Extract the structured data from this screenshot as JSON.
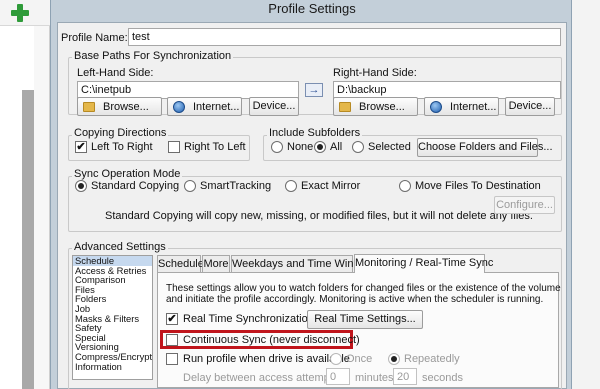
{
  "window": {
    "title": "Profile Settings"
  },
  "profile": {
    "name_label": "Profile Name:",
    "name_value": "test"
  },
  "base_paths": {
    "legend": "Base Paths For Synchronization",
    "left": {
      "label": "Left-Hand Side:",
      "value": "C:\\inetpub",
      "browse": "Browse...",
      "internet": "Internet...",
      "device": "Device..."
    },
    "right": {
      "label": "Right-Hand Side:",
      "value": "D:\\backup",
      "browse": "Browse...",
      "internet": "Internet...",
      "device": "Device..."
    },
    "arrow_left": "→",
    "arrow_right": "⇒",
    "left_icon": "folder-icon",
    "internet_icon": "globe-icon"
  },
  "copying_directions": {
    "legend": "Copying Directions",
    "left_to_right": "Left To Right",
    "right_to_left": "Right To Left",
    "left_to_right_checked": true,
    "right_to_left_checked": false
  },
  "include_subfolders": {
    "legend": "Include Subfolders",
    "options": [
      "None",
      "All",
      "Selected"
    ],
    "selected": "All",
    "button": "Choose Folders and Files..."
  },
  "sync_mode": {
    "legend": "Sync Operation Mode",
    "options": [
      "Standard Copying",
      "SmartTracking",
      "Exact Mirror",
      "Move Files To Destination"
    ],
    "selected": "Standard Copying",
    "description": "Standard Copying will copy new, missing, or modified files, but it will not delete any files.",
    "configure": "Configure..."
  },
  "advanced": {
    "legend": "Advanced Settings",
    "list": [
      "Schedule",
      "Access & Retries",
      "Comparison",
      "Files",
      "Folders",
      "Job",
      "Masks & Filters",
      "Safety",
      "Special",
      "Versioning",
      "Compress/Encrypt",
      "Information"
    ],
    "selected_list_item": "Schedule",
    "tabs": [
      "Schedule",
      "More",
      "Weekdays and Time Window",
      "Monitoring / Real-Time Sync"
    ],
    "active_tab": "Monitoring / Real-Time Sync",
    "panel": {
      "description_line1": "These settings allow you to watch folders for changed files or the existence of the volume",
      "description_line2": "and initiate the profile accordingly. Monitoring is active when the scheduler is running.",
      "real_time_sync": {
        "label": "Real Time Synchronization...",
        "checked": true
      },
      "real_time_settings_button": "Real Time Settings...",
      "continuous_sync": {
        "label": "Continuous Sync (never disconnect)",
        "checked": false
      },
      "run_when_available": {
        "label": "Run profile when drive is available",
        "checked": false
      },
      "once_label": "Once",
      "repeatedly_label": "Repeatedly",
      "run_mode_selected": "Repeatedly",
      "delay_label": "Delay between access attempts:",
      "delay_minutes": "0",
      "minutes_label": "minutes",
      "delay_seconds": "20",
      "seconds_label": "seconds"
    },
    "highlight_color": "#c0151c"
  },
  "colors": {
    "accent_green": "#2f9b3a",
    "dialog_frame": "#c3cfd9",
    "client_bg": "#f0f0f0",
    "selection": "#c6d9ef"
  },
  "background_app": {
    "toolbar_icon": "plus-icon"
  }
}
